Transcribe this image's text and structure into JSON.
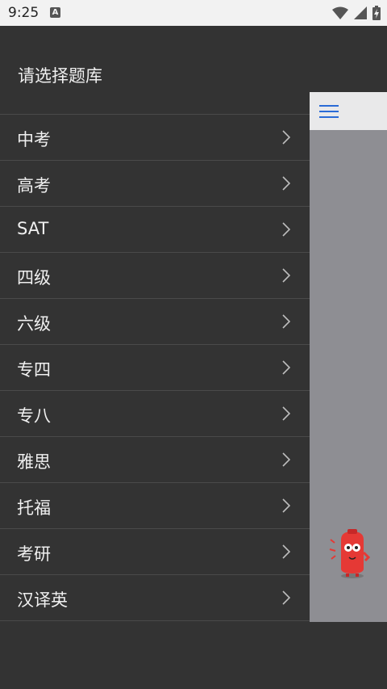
{
  "status_bar": {
    "time": "9:25",
    "notification_icon": "A",
    "icons": [
      "wifi-icon",
      "signal-icon",
      "battery-charging-icon"
    ]
  },
  "drawer": {
    "title": "请选择题库",
    "items": [
      {
        "label": "中考"
      },
      {
        "label": "高考"
      },
      {
        "label": "SAT"
      },
      {
        "label": "四级"
      },
      {
        "label": "六级"
      },
      {
        "label": "专四"
      },
      {
        "label": "专八"
      },
      {
        "label": "雅思"
      },
      {
        "label": "托福"
      },
      {
        "label": "考研"
      },
      {
        "label": "汉译英"
      }
    ]
  },
  "content": {
    "menu_icon": "hamburger-menu-icon",
    "floating_icon": "mascot-icon"
  },
  "colors": {
    "drawer_bg": "#333333",
    "accent": "#2b6bd6",
    "overlay": "#8e8e93"
  }
}
